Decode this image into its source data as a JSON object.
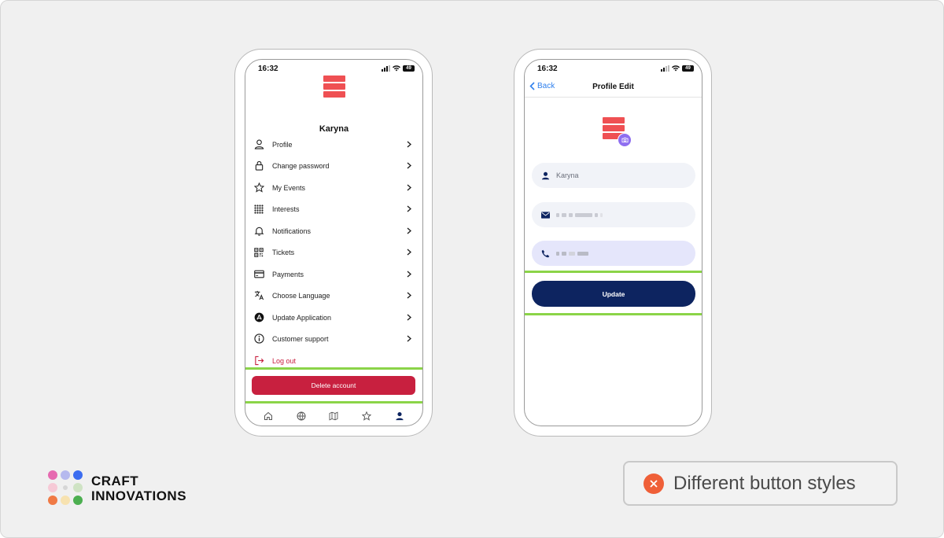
{
  "left_phone": {
    "time": "16:32",
    "battery": "49",
    "user_name": "Karyna",
    "menu": [
      {
        "label": "Profile",
        "icon": "person-icon"
      },
      {
        "label": "Change password",
        "icon": "lock-icon"
      },
      {
        "label": "My Events",
        "icon": "star-icon"
      },
      {
        "label": "Interests",
        "icon": "grid-dots-icon"
      },
      {
        "label": "Notifications",
        "icon": "bell-icon"
      },
      {
        "label": "Tickets",
        "icon": "qr-code-icon"
      },
      {
        "label": "Payments",
        "icon": "credit-card-icon"
      },
      {
        "label": "Choose Language",
        "icon": "translate-icon"
      },
      {
        "label": "Update Application",
        "icon": "app-store-icon"
      },
      {
        "label": "Customer support",
        "icon": "info-icon"
      }
    ],
    "logout_label": "Log out",
    "delete_label": "Delete account",
    "tabs": [
      "home-icon",
      "globe-icon",
      "map-icon",
      "star-icon",
      "profile-icon"
    ]
  },
  "right_phone": {
    "time": "16:32",
    "battery": "49",
    "back_label": "Back",
    "title": "Profile Edit",
    "name_value": "Karyna",
    "update_label": "Update"
  },
  "brand": {
    "line1": "CRAFT",
    "line2": "INNOVATIONS"
  },
  "issue": {
    "text": "Different button styles"
  },
  "colors": {
    "delete_button": "#c8203f",
    "update_button": "#0d2460",
    "highlight_line": "#8bd448",
    "logo": "#ef5053",
    "issue_icon": "#ef5f38"
  }
}
